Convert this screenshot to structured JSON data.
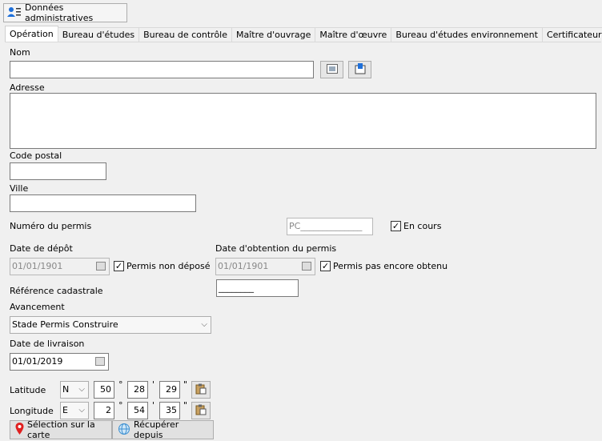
{
  "header": {
    "button_label": "Données administratives"
  },
  "tabs": [
    "Opération",
    "Bureau d'études",
    "Bureau de contrôle",
    "Maître d'ouvrage",
    "Maître d'œuvre",
    "Bureau d'études environnement",
    "Certificateur"
  ],
  "form": {
    "nom_label": "Nom",
    "nom_value": "",
    "adresse_label": "Adresse",
    "code_postal_label": "Code postal",
    "ville_label": "Ville",
    "permis_label": "Numéro du permis",
    "permis_value": "PC______________",
    "en_cours_label": "En cours",
    "en_cours_checked": true,
    "date_depot_label": "Date de dépôt",
    "date_depot_value": "01/01/1901",
    "permis_non_depose_label": "Permis non déposé",
    "date_obtention_label": "Date d'obtention du permis",
    "date_obtention_value": "01/01/1901",
    "permis_pas_obtenu_label": "Permis pas encore obtenu",
    "ref_cadastrale_label": "Référence cadastrale",
    "ref_cadastrale_value": "________",
    "avancement_label": "Avancement",
    "avancement_value": "Stade Permis Construire",
    "date_livraison_label": "Date de livraison",
    "date_livraison_value": "01/01/2019",
    "latitude_label": "Latitude",
    "latitude": {
      "hemisphere": "N",
      "deg": "50",
      "min": "28",
      "sec": "29"
    },
    "longitude_label": "Longitude",
    "longitude": {
      "hemisphere": "E",
      "deg": "2",
      "min": "54",
      "sec": "35"
    },
    "deg_symbol": "°",
    "min_symbol": "'",
    "sec_symbol": "\"",
    "selection_carte_label": "Sélection sur la carte",
    "recuperer_label": "Récupérer depuis"
  },
  "colors": {
    "accent": "#1e6fd9",
    "pin": "#e02020"
  }
}
